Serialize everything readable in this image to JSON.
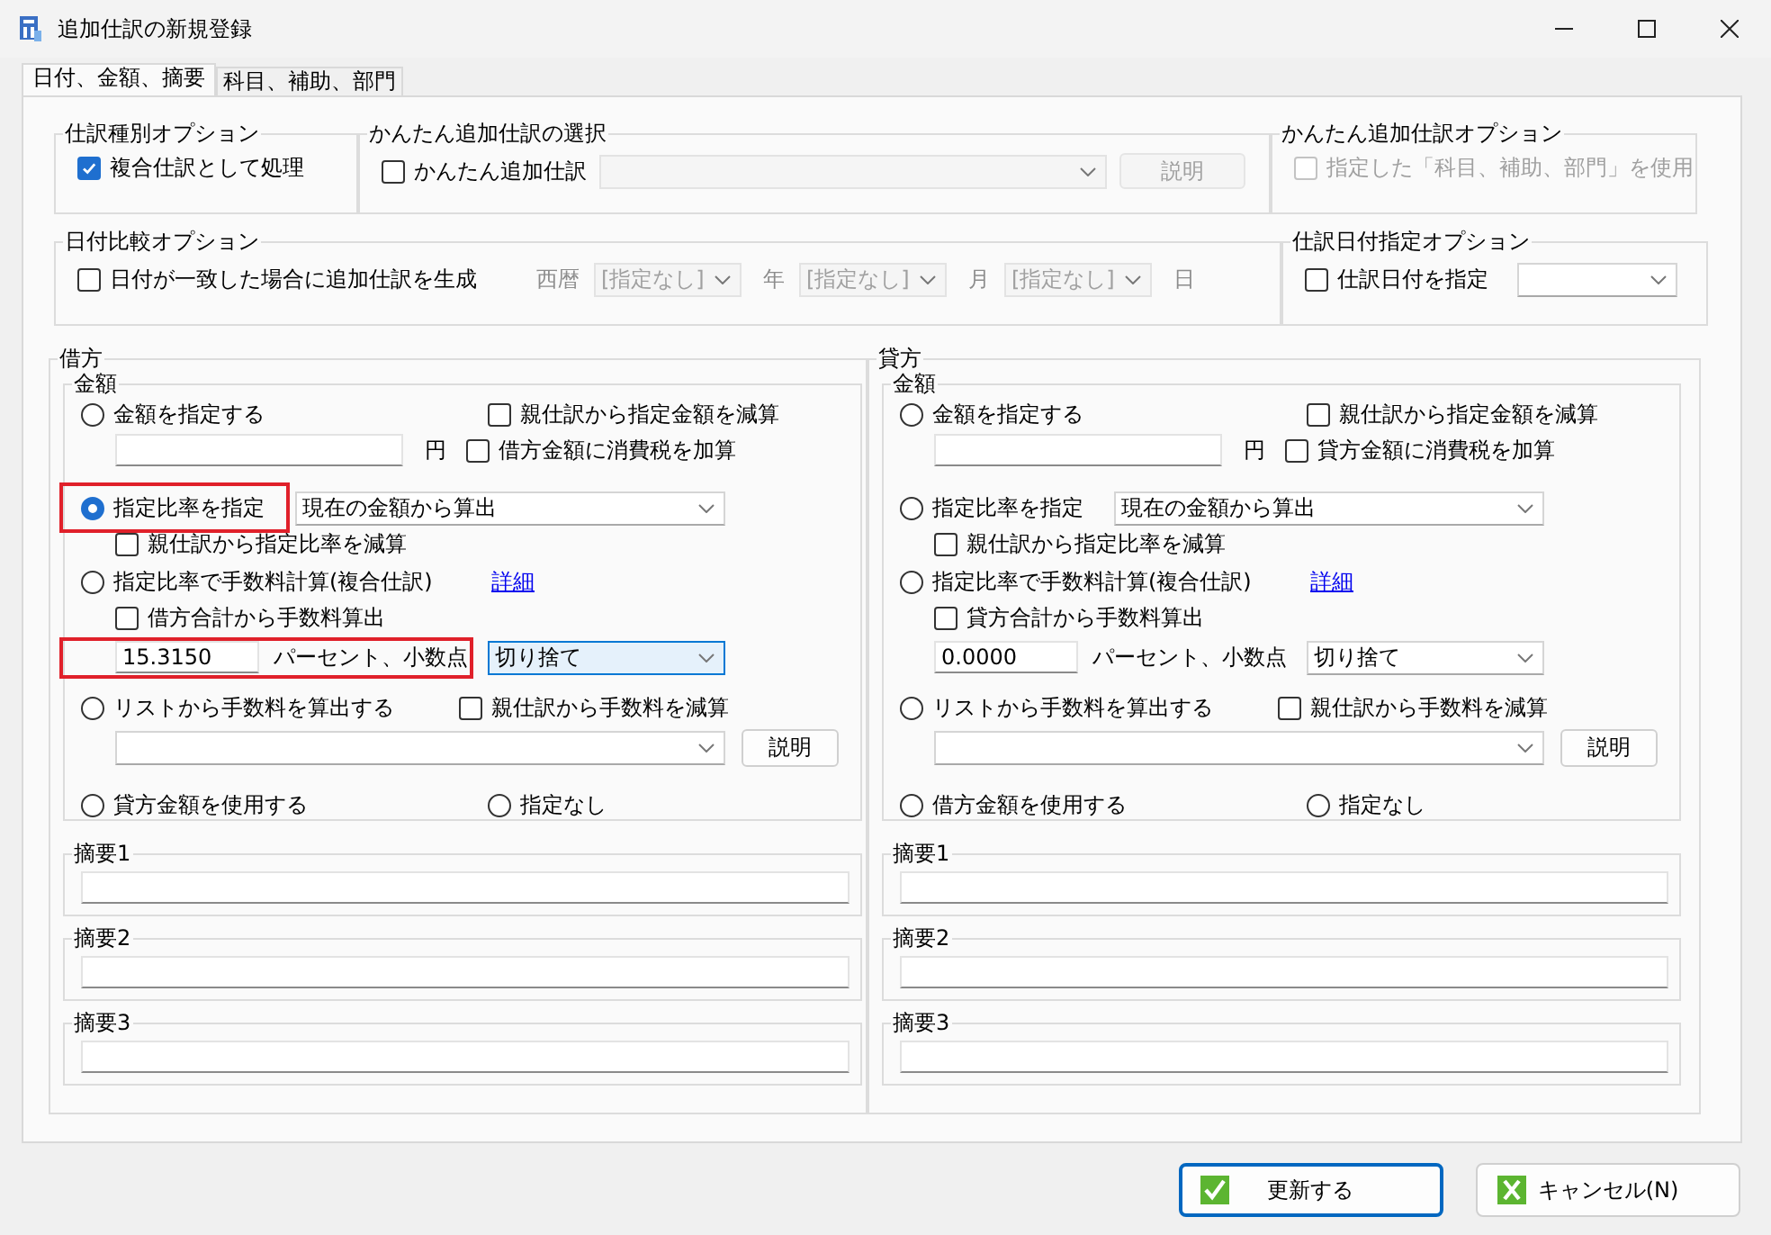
{
  "window": {
    "title": "追加仕訳の新規登録"
  },
  "tabs": [
    {
      "label": "日付、金額、摘要",
      "selected": true
    },
    {
      "label": "科目、補助、部門",
      "selected": false
    }
  ],
  "journal_type_options": {
    "title": "仕訳種別オプション",
    "checkbox": {
      "label": "複合仕訳として処理",
      "checked": true
    }
  },
  "simple_selection": {
    "title": "かんたん追加仕訳の選択",
    "checkbox": {
      "label": "かんたん追加仕訳",
      "checked": false
    },
    "dropdown": {
      "disabled": true
    },
    "button": {
      "label": "説明",
      "disabled": true
    }
  },
  "simple_options": {
    "title": "かんたん追加仕訳オプション",
    "checkbox": {
      "label": "指定した「科目、補助、部門」を使用",
      "checked": false,
      "disabled": true
    }
  },
  "date_compare": {
    "title": "日付比較オプション",
    "checkbox": {
      "label": "日付が一致した場合に追加仕訳を生成",
      "checked": false
    },
    "parts": [
      {
        "kind": "label",
        "text": "西暦",
        "disabled": true
      },
      {
        "kind": "dropdown",
        "text": "[指定なし]",
        "disabled": true
      },
      {
        "kind": "label",
        "text": "年",
        "disabled": true
      },
      {
        "kind": "dropdown",
        "text": "[指定なし]",
        "disabled": true
      },
      {
        "kind": "label",
        "text": "月",
        "disabled": true
      },
      {
        "kind": "dropdown",
        "text": "[指定なし]",
        "disabled": true
      },
      {
        "kind": "label",
        "text": "日",
        "disabled": true
      }
    ]
  },
  "date_option": {
    "title": "仕訳日付指定オプション",
    "checkbox": {
      "label": "仕訳日付を指定",
      "checked": false
    }
  },
  "panes": [
    {
      "title": "借方",
      "amount_title": "金額",
      "fixed": {
        "radio": {
          "label": "金額を指定する",
          "selected": false
        },
        "subtract": {
          "label": "親仕訳から指定金額を減算",
          "checked": false
        },
        "unit": "円",
        "add_tax": {
          "label": "借方金額に消費税を加算",
          "checked": false
        }
      },
      "ratio": {
        "radio": {
          "label": "指定比率を指定",
          "selected": true,
          "highlighted": true
        },
        "source": {
          "value": "現在の金額から算出"
        },
        "subtract": {
          "label": "親仕訳から指定比率を減算",
          "checked": false
        }
      },
      "fee": {
        "radio": {
          "label": "指定比率で手数料計算(複合仕訳)",
          "selected": false
        },
        "link": "詳細",
        "from_total": {
          "label": "借方合計から手数料算出",
          "checked": false
        },
        "percent": {
          "value": "15.3150",
          "highlighted": true
        },
        "unit": "パーセント、小数点",
        "rounding": {
          "value": "切り捨て",
          "focused": true
        }
      },
      "list": {
        "radio": {
          "label": "リストから手数料を算出する",
          "selected": false
        },
        "subtract": {
          "label": "親仕訳から手数料を減算",
          "checked": false
        },
        "button": "説明"
      },
      "use_other": {
        "label": "貸方金額を使用する",
        "selected": false
      },
      "none": {
        "label": "指定なし",
        "selected": false
      },
      "summaries": [
        {
          "title": "摘要1"
        },
        {
          "title": "摘要2"
        },
        {
          "title": "摘要3"
        }
      ]
    },
    {
      "title": "貸方",
      "amount_title": "金額",
      "fixed": {
        "radio": {
          "label": "金額を指定する",
          "selected": false
        },
        "subtract": {
          "label": "親仕訳から指定金額を減算",
          "checked": false
        },
        "unit": "円",
        "add_tax": {
          "label": "貸方金額に消費税を加算",
          "checked": false
        }
      },
      "ratio": {
        "radio": {
          "label": "指定比率を指定",
          "selected": false,
          "highlighted": false
        },
        "source": {
          "value": "現在の金額から算出"
        },
        "subtract": {
          "label": "親仕訳から指定比率を減算",
          "checked": false
        }
      },
      "fee": {
        "radio": {
          "label": "指定比率で手数料計算(複合仕訳)",
          "selected": false
        },
        "link": "詳細",
        "from_total": {
          "label": "貸方合計から手数料算出",
          "checked": false
        },
        "percent": {
          "value": "0.0000",
          "highlighted": false
        },
        "unit": "パーセント、小数点",
        "rounding": {
          "value": "切り捨て",
          "focused": false
        }
      },
      "list": {
        "radio": {
          "label": "リストから手数料を算出する",
          "selected": false
        },
        "subtract": {
          "label": "親仕訳から手数料を減算",
          "checked": false
        },
        "button": "説明"
      },
      "use_other": {
        "label": "借方金額を使用する",
        "selected": false
      },
      "none": {
        "label": "指定なし",
        "selected": false
      },
      "summaries": [
        {
          "title": "摘要1"
        },
        {
          "title": "摘要2"
        },
        {
          "title": "摘要3"
        }
      ]
    }
  ],
  "buttons": [
    {
      "label": "更新する",
      "kind": "ok",
      "focused": true
    },
    {
      "label": "キャンセル(N)",
      "kind": "cancel",
      "focused": false
    }
  ]
}
